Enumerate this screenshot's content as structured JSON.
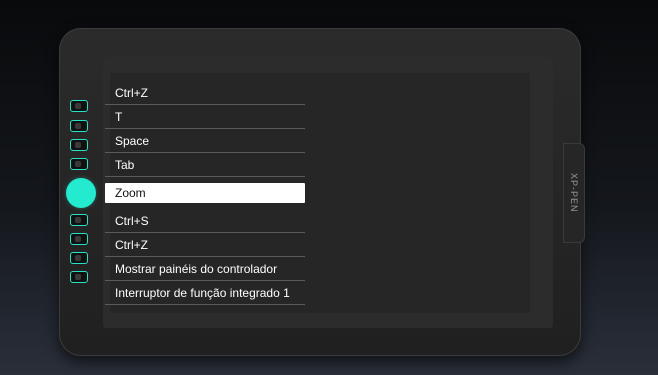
{
  "device": {
    "brand": "XP-PEN",
    "accent_color": "#24ead0"
  },
  "express_keys": {
    "upper": [
      {
        "label": "Ctrl+Z"
      },
      {
        "label": "T"
      },
      {
        "label": "Space"
      },
      {
        "label": "Tab"
      }
    ],
    "dial": {
      "label": "Zoom",
      "selected": true
    },
    "lower": [
      {
        "label": "Ctrl+S"
      },
      {
        "label": "Ctrl+Z"
      },
      {
        "label": "Mostrar painéis do controlador"
      },
      {
        "label": "Interruptor de função integrado 1"
      }
    ]
  }
}
